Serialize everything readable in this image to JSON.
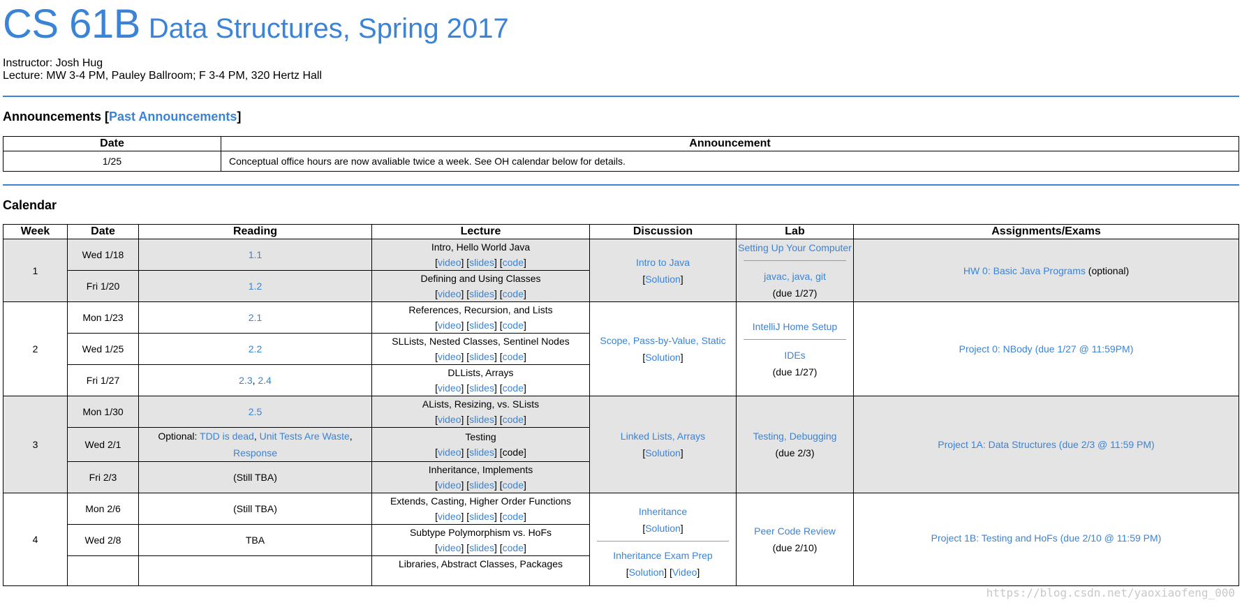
{
  "header": {
    "course_code": "CS 61B",
    "course_title": "Data Structures, Spring 2017",
    "instructor": "Instructor: Josh Hug",
    "lecture": "Lecture: MW 3-4 PM, Pauley Ballroom; F 3-4 PM, 320 Hertz Hall"
  },
  "announcements": {
    "title": "Announcements",
    "past_link": "Past Announcements",
    "columns": [
      "Date",
      "Announcement"
    ],
    "rows": [
      {
        "date": "1/25",
        "text": "Conceptual office hours are now avaliable twice a week. See OH calendar below for details."
      }
    ]
  },
  "calendar": {
    "title": "Calendar",
    "columns": [
      "Week",
      "Date",
      "Reading",
      "Lecture",
      "Discussion",
      "Lab",
      "Assignments/Exams"
    ],
    "lecture_links": {
      "video": "video",
      "slides": "slides",
      "code": "code"
    },
    "rows": [
      {
        "week": "1",
        "date": "Wed 1/18",
        "reading": "1.1",
        "lecture": "Intro, Hello World Java"
      },
      {
        "date": "Fri 1/20",
        "reading": "1.2",
        "lecture": "Defining and Using Classes"
      },
      {
        "week": "2",
        "date": "Mon 1/23",
        "reading": "2.1",
        "lecture": "References, Recursion, and Lists"
      },
      {
        "date": "Wed 1/25",
        "reading": "2.2",
        "lecture": "SLLists, Nested Classes, Sentinel Nodes"
      },
      {
        "date": "Fri 1/27",
        "reading_a": "2.3",
        "reading_b": "2.4",
        "lecture": "DLLists, Arrays"
      },
      {
        "week": "3",
        "date": "Mon 1/30",
        "reading": "2.5",
        "lecture": "ALists, Resizing, vs. SLists"
      },
      {
        "date": "Wed 2/1",
        "reading_prefix": "Optional:",
        "reading_a": "TDD is dead",
        "reading_b": "Unit Tests Are Waste",
        "reading_c": "Response",
        "lecture": "Testing"
      },
      {
        "date": "Fri 2/3",
        "reading": "(Still TBA)",
        "lecture": "Inheritance, Implements"
      },
      {
        "week": "4",
        "date": "Mon 2/6",
        "reading": "(Still TBA)",
        "lecture": "Extends, Casting, Higher Order Functions"
      },
      {
        "date": "Wed 2/8",
        "reading": "TBA",
        "lecture": "Subtype Polymorphism vs. HoFs"
      },
      {
        "lecture": "Libraries, Abstract Classes, Packages"
      }
    ],
    "discussion": {
      "w1": "Intro to Java",
      "w2": "Scope, Pass-by-Value, Static",
      "w3": "Linked Lists, Arrays",
      "w4a": "Inheritance",
      "w4b": "Inheritance Exam Prep",
      "solution": "Solution",
      "video": "Video"
    },
    "lab": {
      "w1a": "Setting Up Your Computer",
      "w1b": "javac, java, git",
      "w1due": "(due 1/27)",
      "w2a": "IntelliJ Home Setup",
      "w2b": "IDEs",
      "w2due": "(due 1/27)",
      "w3": "Testing, Debugging",
      "w3due": "(due 2/3)",
      "w4": "Peer Code Review",
      "w4due": "(due 2/10)"
    },
    "assignments": {
      "w1": "HW 0: Basic Java Programs",
      "w1_note": "(optional)",
      "w2": "Project 0: NBody (due 1/27 @ 11:59PM)",
      "w3": "Project 1A: Data Structures (due 2/3 @ 11:59 PM)",
      "w4": "Project 1B: Testing and HoFs (due 2/10 @ 11:59 PM)"
    }
  },
  "watermark": "https://blog.csdn.net/yaoxiaofeng_000"
}
